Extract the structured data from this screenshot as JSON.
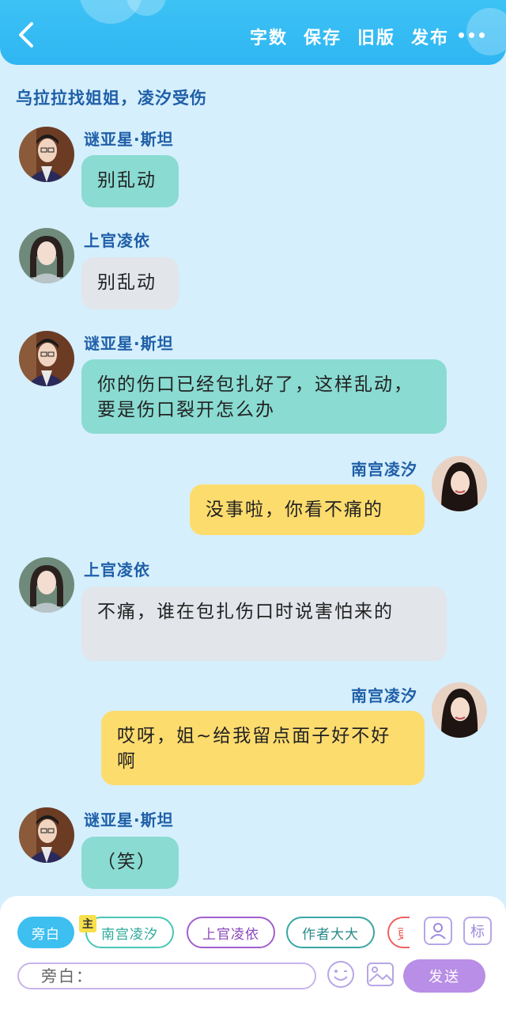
{
  "header": {
    "actions": [
      "字数",
      "保存",
      "旧版",
      "发布"
    ]
  },
  "chat": {
    "title": "乌拉拉找姐姐，凌汐受伤",
    "messages": [
      {
        "sender": "谜亚星·斯坦",
        "text": "别乱动",
        "side": "left",
        "style": "green"
      },
      {
        "sender": "上官凌依",
        "text": "别乱动",
        "side": "left",
        "style": "grey"
      },
      {
        "sender": "谜亚星·斯坦",
        "text": "你的伤口已经包扎好了，这样乱动，要是伤口裂开怎么办",
        "side": "left",
        "style": "green"
      },
      {
        "sender": "南宫凌汐",
        "text": "没事啦，你看不痛的",
        "side": "right",
        "style": "yellow"
      },
      {
        "sender": "上官凌依",
        "text": "不痛，谁在包扎伤口时说害怕来的",
        "side": "left",
        "style": "grey"
      },
      {
        "sender": "南宫凌汐",
        "text": "哎呀，姐~给我留点面子好不好啊",
        "side": "right",
        "style": "yellow"
      },
      {
        "sender": "谜亚星·斯坦",
        "text": "（笑）",
        "side": "left",
        "style": "green"
      }
    ]
  },
  "composer": {
    "roles": [
      {
        "label": "旁白",
        "color": "#3dbff0"
      },
      {
        "label": "南宫凌汐",
        "color": "#49c7b4"
      },
      {
        "label": "上官凌依",
        "color": "#a15fcf"
      },
      {
        "label": "作者大大",
        "color": "#3aa5a5"
      },
      {
        "label": "更多",
        "color": "#f06060"
      }
    ],
    "main_badge": "主",
    "tag_button_label": "标",
    "input_placeholder": "旁白：",
    "send_label": "发送"
  }
}
